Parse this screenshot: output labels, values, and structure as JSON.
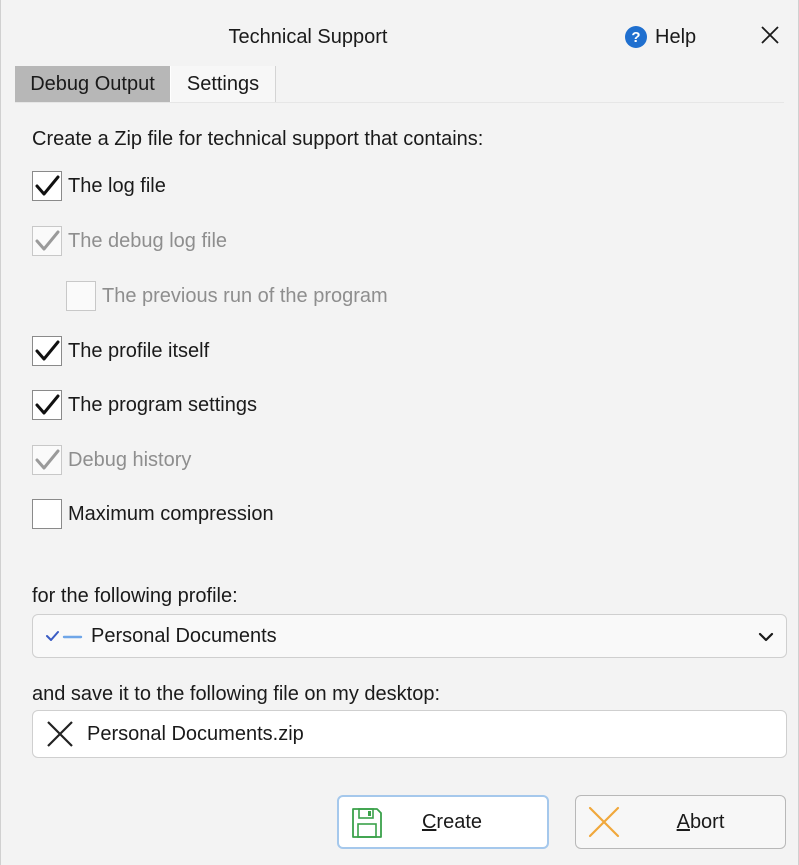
{
  "window": {
    "title": "Technical Support",
    "help_label": "Help"
  },
  "tabs": [
    {
      "label": "Debug Output",
      "active": true
    },
    {
      "label": "Settings",
      "active": false
    }
  ],
  "intro_text": "Create a Zip file for technical support that contains:",
  "options": [
    {
      "label": "The log file",
      "checked": true,
      "enabled": true
    },
    {
      "label": "The debug log file",
      "checked": true,
      "enabled": false
    },
    {
      "label": "The previous run of the program",
      "checked": false,
      "enabled": false
    },
    {
      "label": "The profile itself",
      "checked": true,
      "enabled": true
    },
    {
      "label": "The program settings",
      "checked": true,
      "enabled": true
    },
    {
      "label": "Debug history",
      "checked": true,
      "enabled": false
    },
    {
      "label": "Maximum compression",
      "checked": false,
      "enabled": true
    }
  ],
  "profile": {
    "label": "for the following profile:",
    "selected": "Personal Documents"
  },
  "save": {
    "label": "and save it to the following file on my desktop:",
    "filename": "Personal Documents.zip"
  },
  "buttons": {
    "create_first": "C",
    "create_rest": "reate",
    "abort_first": "A",
    "abort_rest": "bort"
  },
  "colors": {
    "accent_blue": "#1f6fcf",
    "active_tab": "#b7b7b7",
    "save_icon_green": "#3aa14a",
    "abort_icon_orange": "#f0a83c"
  }
}
